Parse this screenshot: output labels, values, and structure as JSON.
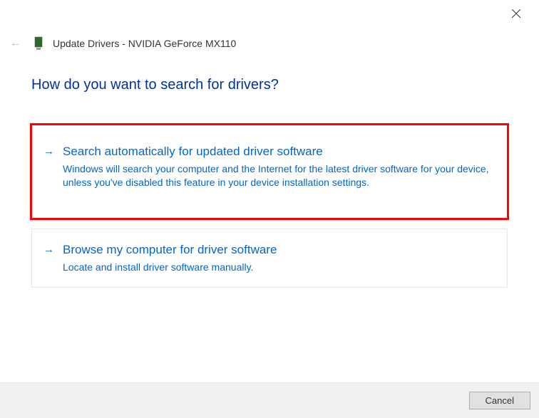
{
  "window": {
    "title": "Update Drivers - NVIDIA GeForce MX110"
  },
  "heading": "How do you want to search for drivers?",
  "options": [
    {
      "title": "Search automatically for updated driver software",
      "description": "Windows will search your computer and the Internet for the latest driver software for your device, unless you've disabled this feature in your device installation settings."
    },
    {
      "title": "Browse my computer for driver software",
      "description": "Locate and install driver software manually."
    }
  ],
  "footer": {
    "cancel_label": "Cancel"
  }
}
